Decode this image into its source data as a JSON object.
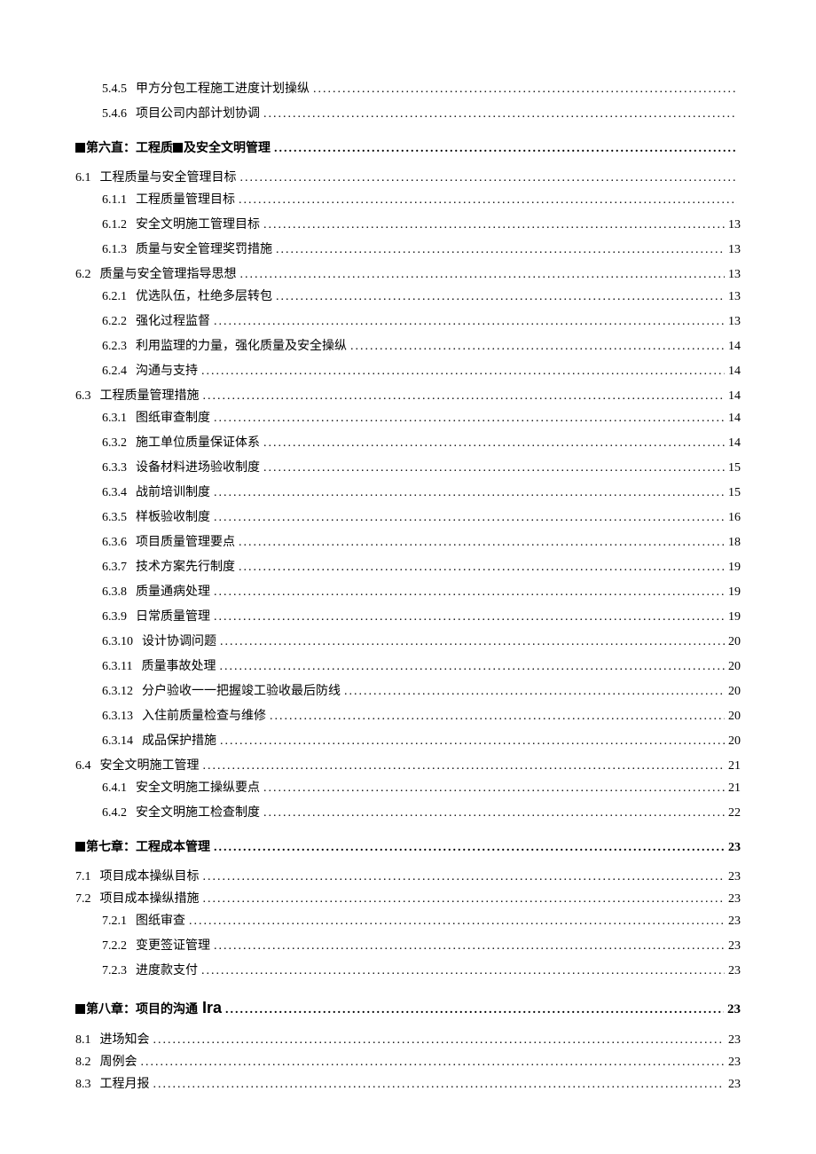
{
  "items": [
    {
      "level": 3,
      "num": "5.4.5",
      "title": "甲方分包工程施工进度计划操纵",
      "page": ""
    },
    {
      "level": 3,
      "num": "5.4.6",
      "title": "项目公司内部计划协调",
      "page": ""
    },
    {
      "level": 1,
      "type": "chapter",
      "pre_marker": true,
      "inline_marker_after": "第六直：工程质",
      "title_rest": "及安全文明管理",
      "page": ""
    },
    {
      "level": 2,
      "num": "6.1",
      "title": "工程质量与安全管理目标",
      "page": ""
    },
    {
      "level": 3,
      "num": "6.1.1",
      "title": "工程质量管理目标",
      "page": ""
    },
    {
      "level": 3,
      "num": "6.1.2",
      "title": "安全文明施工管理目标",
      "page": "13"
    },
    {
      "level": 3,
      "num": "6.1.3",
      "title": "质量与安全管理奖罚措施",
      "page": "13"
    },
    {
      "level": 2,
      "num": "6.2",
      "title": "质量与安全管理指导思想",
      "page": "13"
    },
    {
      "level": 3,
      "num": "6.2.1",
      "title": "优选队伍，杜绝多层转包",
      "page": "13"
    },
    {
      "level": 3,
      "num": "6.2.2",
      "title": "强化过程监督",
      "page": "13"
    },
    {
      "level": 3,
      "num": "6.2.3",
      "title": "利用监理的力量，强化质量及安全操纵",
      "page": "14"
    },
    {
      "level": 3,
      "num": "6.2.4",
      "title": "沟通与支持",
      "page": "14"
    },
    {
      "level": 2,
      "num": "6.3",
      "title": "工程质量管理措施",
      "page": "14"
    },
    {
      "level": 3,
      "num": "6.3.1",
      "title": "图纸审查制度",
      "page": "14"
    },
    {
      "level": 3,
      "num": "6.3.2",
      "title": "施工单位质量保证体系",
      "page": "14"
    },
    {
      "level": 3,
      "num": "6.3.3",
      "title": "设备材料进场验收制度",
      "page": "15"
    },
    {
      "level": 3,
      "num": "6.3.4",
      "title": "战前培训制度",
      "page": "15"
    },
    {
      "level": 3,
      "num": "6.3.5",
      "title": "样板验收制度",
      "page": "16"
    },
    {
      "level": 3,
      "num": "6.3.6",
      "title": "项目质量管理要点",
      "page": "18"
    },
    {
      "level": 3,
      "num": "6.3.7",
      "title": "技术方案先行制度",
      "page": "19"
    },
    {
      "level": 3,
      "num": "6.3.8",
      "title": "质量通病处理",
      "page": "19"
    },
    {
      "level": 3,
      "num": "6.3.9",
      "title": "日常质量管理",
      "page": "19"
    },
    {
      "level": 3,
      "num": "6.3.10",
      "title": "设计协调问题",
      "page": "20"
    },
    {
      "level": 3,
      "num": "6.3.11",
      "title": "质量事故处理",
      "page": "20"
    },
    {
      "level": 3,
      "num": "6.3.12",
      "title": "分户验收一一把握竣工验收最后防线",
      "page": "20"
    },
    {
      "level": 3,
      "num": "6.3.13",
      "title": "入住前质量检查与维修",
      "page": "20"
    },
    {
      "level": 3,
      "num": "6.3.14",
      "title": "成品保护措施",
      "page": "20"
    },
    {
      "level": 2,
      "num": "6.4",
      "title": "安全文明施工管理",
      "page": "21"
    },
    {
      "level": 3,
      "num": "6.4.1",
      "title": "安全文明施工操纵要点",
      "page": "21"
    },
    {
      "level": 3,
      "num": "6.4.2",
      "title": "安全文明施工检查制度",
      "page": "22"
    },
    {
      "level": 1,
      "type": "chapter",
      "pre_marker": true,
      "title": "第七章：工程成本管理",
      "page": "23"
    },
    {
      "level": 2,
      "num": "7.1",
      "title": "项目成本操纵目标",
      "page": "23"
    },
    {
      "level": 2,
      "num": "7.2",
      "title": "项目成本操纵措施",
      "page": "23"
    },
    {
      "level": 3,
      "num": "7.2.1",
      "title": "图纸审查",
      "page": "23"
    },
    {
      "level": 3,
      "num": "7.2.2",
      "title": "变更签证管理",
      "page": "23"
    },
    {
      "level": 3,
      "num": "7.2.3",
      "title": "进度款支付",
      "page": "23"
    },
    {
      "level": 1,
      "type": "chapter_special",
      "pre_marker": true,
      "title_a": "第八章：项目的沟通",
      "title_big": " Ira",
      "page": "23"
    },
    {
      "level": 2,
      "num": "8.1",
      "title": "进场知会",
      "page": "23"
    },
    {
      "level": 2,
      "num": "8.2",
      "title": "周例会",
      "page": "23"
    },
    {
      "level": 2,
      "num": "8.3",
      "title": "工程月报",
      "page": "23"
    }
  ]
}
